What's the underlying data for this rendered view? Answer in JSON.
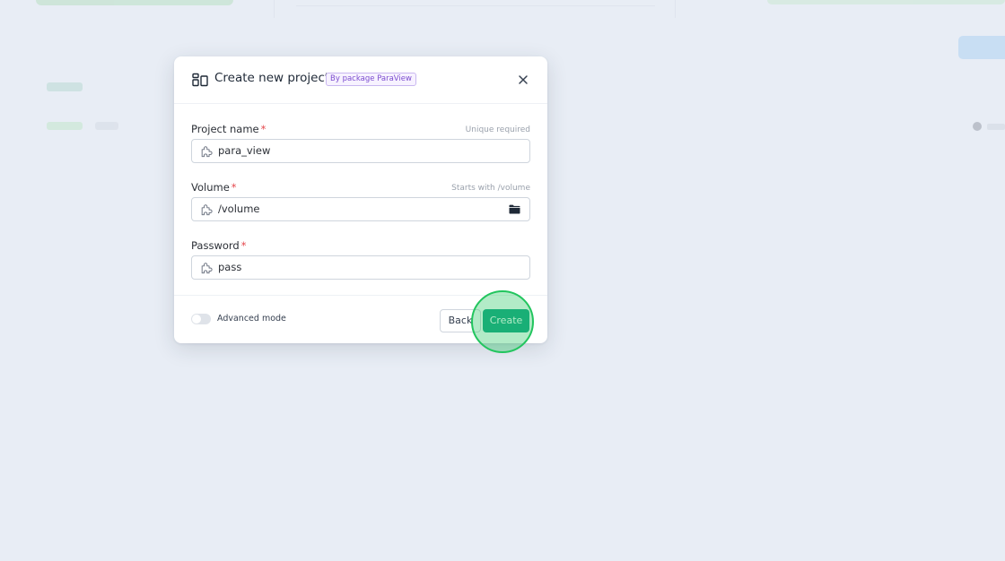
{
  "modal": {
    "title": "Create new project",
    "badge": "By package ParaView"
  },
  "fields": {
    "project_name": {
      "label": "Project name",
      "required_mark": "*",
      "hint": "Unique required",
      "value": "para_view"
    },
    "volume": {
      "label": "Volume",
      "required_mark": "*",
      "hint": "Starts with /volume",
      "value": "/volume"
    },
    "password": {
      "label": "Password",
      "required_mark": "*",
      "value": "pass"
    }
  },
  "footer": {
    "advanced_mode_label": "Advanced mode",
    "advanced_mode_on": false,
    "back_label": "Back",
    "create_label": "Create"
  },
  "icons": {
    "header": "project-layout-icon",
    "close": "close-icon",
    "field": "puzzle-icon",
    "browse": "folder-icon"
  },
  "colors": {
    "primary": "#14a383",
    "badge_text": "#7c4dcf",
    "required": "#e5484d",
    "click_highlight": "#22c55e"
  }
}
